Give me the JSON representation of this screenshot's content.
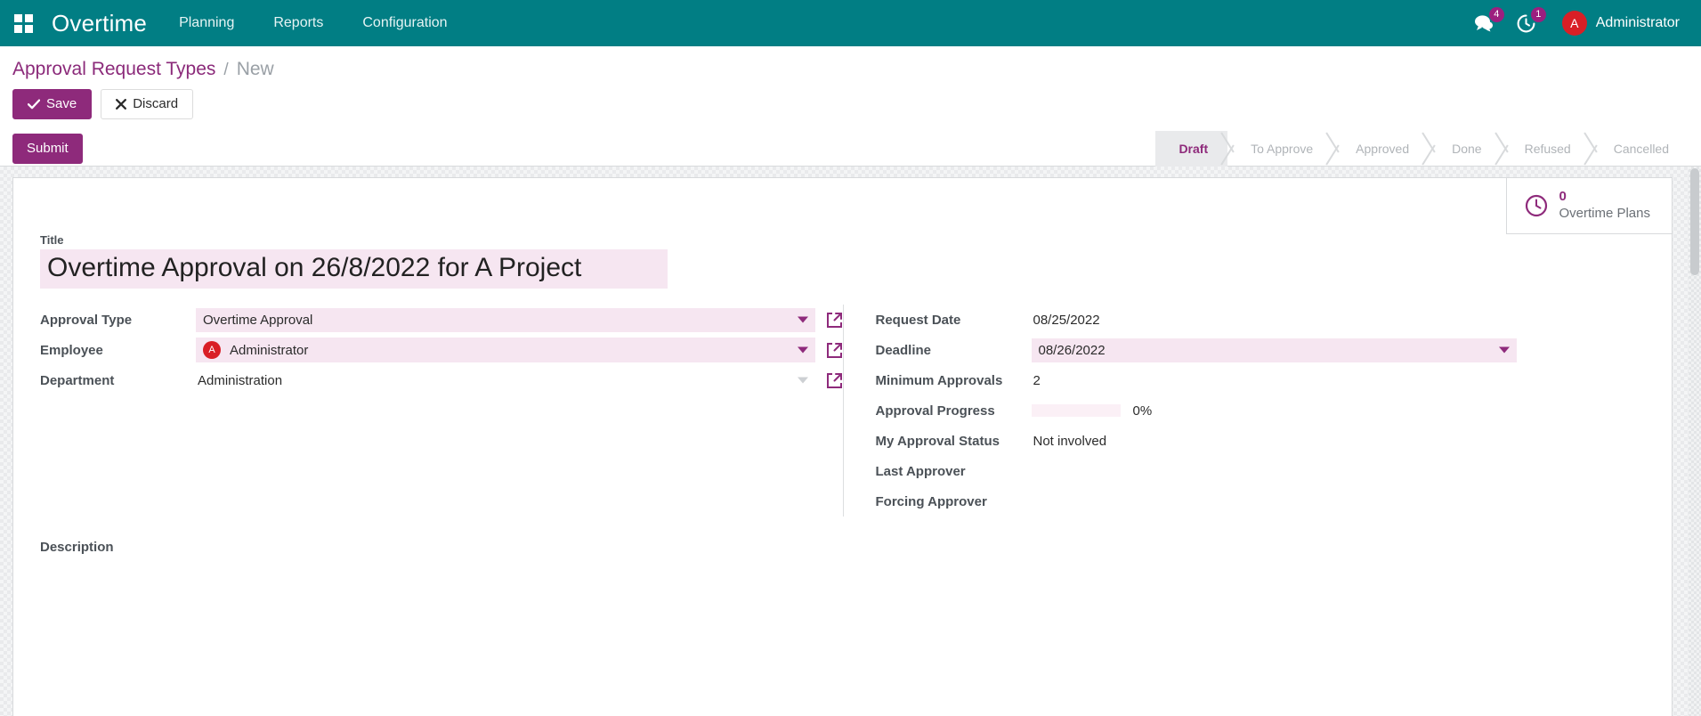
{
  "theme": {
    "navbar_color": "#017e84",
    "accent_purple": "#8e2a7b",
    "field_highlight": "#f6e6f1",
    "avatar_red": "#d91f26"
  },
  "navbar": {
    "apps_icon": "apps-grid-icon",
    "brand": "Overtime",
    "menu": [
      {
        "label": "Planning"
      },
      {
        "label": "Reports"
      },
      {
        "label": "Configuration"
      }
    ],
    "messages_icon": "messages-icon",
    "messages_count": "4",
    "activities_icon": "clock-activity-icon",
    "activities_count": "1",
    "user_initial": "A",
    "user_name": "Administrator"
  },
  "breadcrumb": {
    "parent": "Approval Request Types",
    "separator": "/",
    "current": "New"
  },
  "actions": {
    "save_icon": "check-icon",
    "save_label": "Save",
    "discard_icon": "close-x-icon",
    "discard_label": "Discard"
  },
  "statusbar": {
    "submit_label": "Submit",
    "steps": [
      {
        "label": "Draft",
        "active": true
      },
      {
        "label": "To Approve",
        "active": false
      },
      {
        "label": "Approved",
        "active": false
      },
      {
        "label": "Done",
        "active": false
      },
      {
        "label": "Refused",
        "active": false
      },
      {
        "label": "Cancelled",
        "active": false
      }
    ]
  },
  "smart_buttons": [
    {
      "icon": "clock-icon",
      "value": "0",
      "label": "Overtime Plans"
    }
  ],
  "form": {
    "title_label": "Title",
    "title_value": "Overtime Approval on 26/8/2022 for A Project",
    "left_fields": [
      {
        "label": "Approval Type",
        "value": "Overtime Approval",
        "type": "many2one",
        "highlighted": true,
        "caret": "active",
        "external_link_icon": "external-link-icon"
      },
      {
        "label": "Employee",
        "value": "Administrator",
        "type": "many2one-avatar",
        "avatar_initial": "A",
        "highlighted": true,
        "caret": "active",
        "external_link_icon": "external-link-icon"
      },
      {
        "label": "Department",
        "value": "Administration",
        "type": "many2one",
        "highlighted": false,
        "caret": "muted",
        "external_link_icon": "external-link-icon"
      }
    ],
    "right_fields": [
      {
        "label": "Request Date",
        "value": "08/25/2022",
        "type": "text",
        "highlighted": false
      },
      {
        "label": "Deadline",
        "value": "08/26/2022",
        "type": "date",
        "highlighted": true,
        "caret": "active"
      },
      {
        "label": "Minimum Approvals",
        "value": "2",
        "type": "text",
        "highlighted": false
      },
      {
        "label": "Approval Progress",
        "value": "0%",
        "type": "progress",
        "progress_percent": 0
      },
      {
        "label": "My Approval Status",
        "value": "Not involved",
        "type": "text",
        "highlighted": false
      },
      {
        "label": "Last Approver",
        "value": "",
        "type": "text",
        "highlighted": false
      },
      {
        "label": "Forcing Approver",
        "value": "",
        "type": "text",
        "highlighted": false
      }
    ],
    "description_label": "Description",
    "description_value": ""
  }
}
